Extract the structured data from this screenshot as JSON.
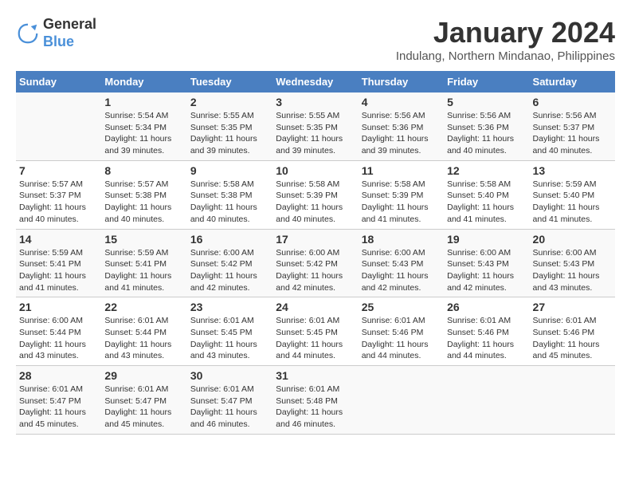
{
  "logo": {
    "line1": "General",
    "line2": "Blue"
  },
  "title": "January 2024",
  "subtitle": "Indulang, Northern Mindanao, Philippines",
  "days_header": [
    "Sunday",
    "Monday",
    "Tuesday",
    "Wednesday",
    "Thursday",
    "Friday",
    "Saturday"
  ],
  "weeks": [
    [
      {
        "day": "",
        "sunrise": "",
        "sunset": "",
        "daylight": ""
      },
      {
        "day": "1",
        "sunrise": "Sunrise: 5:54 AM",
        "sunset": "Sunset: 5:34 PM",
        "daylight": "Daylight: 11 hours and 39 minutes."
      },
      {
        "day": "2",
        "sunrise": "Sunrise: 5:55 AM",
        "sunset": "Sunset: 5:35 PM",
        "daylight": "Daylight: 11 hours and 39 minutes."
      },
      {
        "day": "3",
        "sunrise": "Sunrise: 5:55 AM",
        "sunset": "Sunset: 5:35 PM",
        "daylight": "Daylight: 11 hours and 39 minutes."
      },
      {
        "day": "4",
        "sunrise": "Sunrise: 5:56 AM",
        "sunset": "Sunset: 5:36 PM",
        "daylight": "Daylight: 11 hours and 39 minutes."
      },
      {
        "day": "5",
        "sunrise": "Sunrise: 5:56 AM",
        "sunset": "Sunset: 5:36 PM",
        "daylight": "Daylight: 11 hours and 40 minutes."
      },
      {
        "day": "6",
        "sunrise": "Sunrise: 5:56 AM",
        "sunset": "Sunset: 5:37 PM",
        "daylight": "Daylight: 11 hours and 40 minutes."
      }
    ],
    [
      {
        "day": "7",
        "sunrise": "Sunrise: 5:57 AM",
        "sunset": "Sunset: 5:37 PM",
        "daylight": "Daylight: 11 hours and 40 minutes."
      },
      {
        "day": "8",
        "sunrise": "Sunrise: 5:57 AM",
        "sunset": "Sunset: 5:38 PM",
        "daylight": "Daylight: 11 hours and 40 minutes."
      },
      {
        "day": "9",
        "sunrise": "Sunrise: 5:58 AM",
        "sunset": "Sunset: 5:38 PM",
        "daylight": "Daylight: 11 hours and 40 minutes."
      },
      {
        "day": "10",
        "sunrise": "Sunrise: 5:58 AM",
        "sunset": "Sunset: 5:39 PM",
        "daylight": "Daylight: 11 hours and 40 minutes."
      },
      {
        "day": "11",
        "sunrise": "Sunrise: 5:58 AM",
        "sunset": "Sunset: 5:39 PM",
        "daylight": "Daylight: 11 hours and 41 minutes."
      },
      {
        "day": "12",
        "sunrise": "Sunrise: 5:58 AM",
        "sunset": "Sunset: 5:40 PM",
        "daylight": "Daylight: 11 hours and 41 minutes."
      },
      {
        "day": "13",
        "sunrise": "Sunrise: 5:59 AM",
        "sunset": "Sunset: 5:40 PM",
        "daylight": "Daylight: 11 hours and 41 minutes."
      }
    ],
    [
      {
        "day": "14",
        "sunrise": "Sunrise: 5:59 AM",
        "sunset": "Sunset: 5:41 PM",
        "daylight": "Daylight: 11 hours and 41 minutes."
      },
      {
        "day": "15",
        "sunrise": "Sunrise: 5:59 AM",
        "sunset": "Sunset: 5:41 PM",
        "daylight": "Daylight: 11 hours and 41 minutes."
      },
      {
        "day": "16",
        "sunrise": "Sunrise: 6:00 AM",
        "sunset": "Sunset: 5:42 PM",
        "daylight": "Daylight: 11 hours and 42 minutes."
      },
      {
        "day": "17",
        "sunrise": "Sunrise: 6:00 AM",
        "sunset": "Sunset: 5:42 PM",
        "daylight": "Daylight: 11 hours and 42 minutes."
      },
      {
        "day": "18",
        "sunrise": "Sunrise: 6:00 AM",
        "sunset": "Sunset: 5:43 PM",
        "daylight": "Daylight: 11 hours and 42 minutes."
      },
      {
        "day": "19",
        "sunrise": "Sunrise: 6:00 AM",
        "sunset": "Sunset: 5:43 PM",
        "daylight": "Daylight: 11 hours and 42 minutes."
      },
      {
        "day": "20",
        "sunrise": "Sunrise: 6:00 AM",
        "sunset": "Sunset: 5:43 PM",
        "daylight": "Daylight: 11 hours and 43 minutes."
      }
    ],
    [
      {
        "day": "21",
        "sunrise": "Sunrise: 6:00 AM",
        "sunset": "Sunset: 5:44 PM",
        "daylight": "Daylight: 11 hours and 43 minutes."
      },
      {
        "day": "22",
        "sunrise": "Sunrise: 6:01 AM",
        "sunset": "Sunset: 5:44 PM",
        "daylight": "Daylight: 11 hours and 43 minutes."
      },
      {
        "day": "23",
        "sunrise": "Sunrise: 6:01 AM",
        "sunset": "Sunset: 5:45 PM",
        "daylight": "Daylight: 11 hours and 43 minutes."
      },
      {
        "day": "24",
        "sunrise": "Sunrise: 6:01 AM",
        "sunset": "Sunset: 5:45 PM",
        "daylight": "Daylight: 11 hours and 44 minutes."
      },
      {
        "day": "25",
        "sunrise": "Sunrise: 6:01 AM",
        "sunset": "Sunset: 5:46 PM",
        "daylight": "Daylight: 11 hours and 44 minutes."
      },
      {
        "day": "26",
        "sunrise": "Sunrise: 6:01 AM",
        "sunset": "Sunset: 5:46 PM",
        "daylight": "Daylight: 11 hours and 44 minutes."
      },
      {
        "day": "27",
        "sunrise": "Sunrise: 6:01 AM",
        "sunset": "Sunset: 5:46 PM",
        "daylight": "Daylight: 11 hours and 45 minutes."
      }
    ],
    [
      {
        "day": "28",
        "sunrise": "Sunrise: 6:01 AM",
        "sunset": "Sunset: 5:47 PM",
        "daylight": "Daylight: 11 hours and 45 minutes."
      },
      {
        "day": "29",
        "sunrise": "Sunrise: 6:01 AM",
        "sunset": "Sunset: 5:47 PM",
        "daylight": "Daylight: 11 hours and 45 minutes."
      },
      {
        "day": "30",
        "sunrise": "Sunrise: 6:01 AM",
        "sunset": "Sunset: 5:47 PM",
        "daylight": "Daylight: 11 hours and 46 minutes."
      },
      {
        "day": "31",
        "sunrise": "Sunrise: 6:01 AM",
        "sunset": "Sunset: 5:48 PM",
        "daylight": "Daylight: 11 hours and 46 minutes."
      },
      {
        "day": "",
        "sunrise": "",
        "sunset": "",
        "daylight": ""
      },
      {
        "day": "",
        "sunrise": "",
        "sunset": "",
        "daylight": ""
      },
      {
        "day": "",
        "sunrise": "",
        "sunset": "",
        "daylight": ""
      }
    ]
  ]
}
